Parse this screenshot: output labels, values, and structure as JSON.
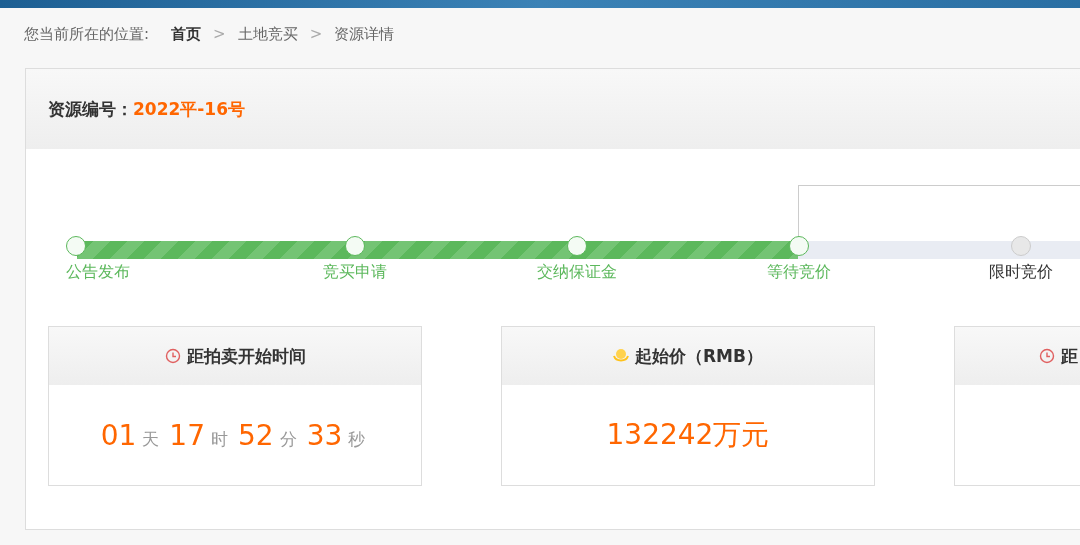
{
  "breadcrumb": {
    "label": "您当前所在的位置:",
    "items": [
      {
        "text": "首页",
        "current": true
      },
      {
        "text": "土地竞买",
        "current": false
      },
      {
        "text": "资源详情",
        "current": false
      }
    ],
    "separator": ">"
  },
  "resource": {
    "label": "资源编号：",
    "value": "2022平-16号"
  },
  "steps": [
    {
      "label": "公告发布",
      "done": true
    },
    {
      "label": "竞买申请",
      "done": true
    },
    {
      "label": "交纳保证金",
      "done": true
    },
    {
      "label": "等待竞价",
      "done": true
    },
    {
      "label": "限时竞价",
      "done": false
    }
  ],
  "cards": [
    {
      "kind": "countdown",
      "title": "距拍卖开始时间",
      "parts": [
        {
          "value": "01",
          "unit": "天"
        },
        {
          "value": "17",
          "unit": "时"
        },
        {
          "value": "52",
          "unit": "分"
        },
        {
          "value": "33",
          "unit": "秒"
        }
      ]
    },
    {
      "kind": "price",
      "title": "起始价（RMB）",
      "value": "132242万元"
    },
    {
      "kind": "partial",
      "title": "距"
    }
  ]
}
